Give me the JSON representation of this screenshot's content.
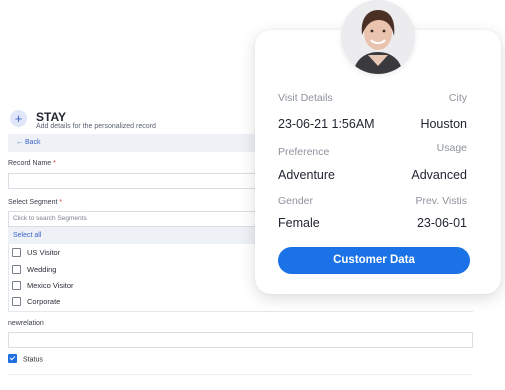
{
  "form": {
    "title": "STAY",
    "subtitle": "Add details for the personalized record",
    "back_label": "← Back",
    "record_name_label": "Record Name",
    "record_name_value": "",
    "select_segment_label": "Select Segment",
    "required_marker": "*",
    "search_placeholder": "Click to search Segments",
    "select_all_label": "Select all",
    "segments": [
      {
        "label": "US Visitor",
        "checked": false
      },
      {
        "label": "Wedding",
        "checked": false
      },
      {
        "label": "Mexico Visitor",
        "checked": false
      },
      {
        "label": "Corporate",
        "checked": false
      }
    ],
    "newrelation_label": "newrelation",
    "newrelation_value": "",
    "status_label": "Status",
    "status_checked": true
  },
  "card": {
    "rows": [
      {
        "label_left": "Visit Details",
        "label_right": "City",
        "value_left": "23-06-21  1:56AM",
        "value_right": "Houston"
      },
      {
        "label_left": "Preference",
        "label_right": "Usage",
        "value_left": "Adventure",
        "value_right": "Advanced"
      },
      {
        "label_left": "Gender",
        "label_right": "Prev. Vistis",
        "value_left": "Female",
        "value_right": "23-06-01"
      }
    ],
    "cta_label": "Customer Data"
  },
  "colors": {
    "accent": "#1a72e6",
    "link": "#3a64c8",
    "muted": "#8e939c"
  }
}
